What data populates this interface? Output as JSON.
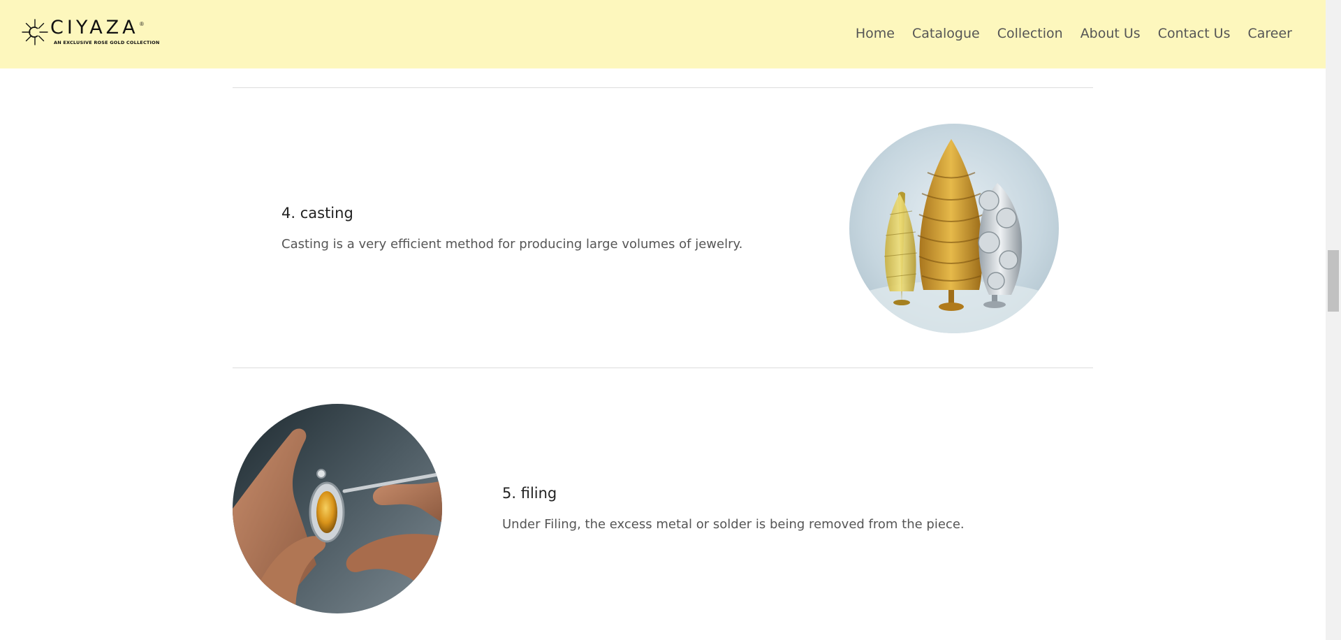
{
  "brand": {
    "name": "CIYAZA",
    "registered_mark": "®",
    "tagline": "AN EXCLUSIVE ROSE GOLD COLLECTION"
  },
  "nav": {
    "items": [
      {
        "label": "Home"
      },
      {
        "label": "Catalogue"
      },
      {
        "label": "Collection"
      },
      {
        "label": "About Us"
      },
      {
        "label": "Contact Us"
      },
      {
        "label": "Career"
      }
    ]
  },
  "steps": [
    {
      "title": "4. casting",
      "description": "Casting is a very efficient method for producing large volumes of jewelry.",
      "image": "casting-trees-image"
    },
    {
      "title": "5. filing",
      "description": "Under Filing, the excess metal or solder is being removed from the piece.",
      "image": "filing-hands-image"
    }
  ],
  "colors": {
    "header_bg": "#fdf7bd",
    "nav_text": "#555555",
    "title_text": "#222222",
    "body_text": "#555555",
    "divider": "#dddddd"
  }
}
